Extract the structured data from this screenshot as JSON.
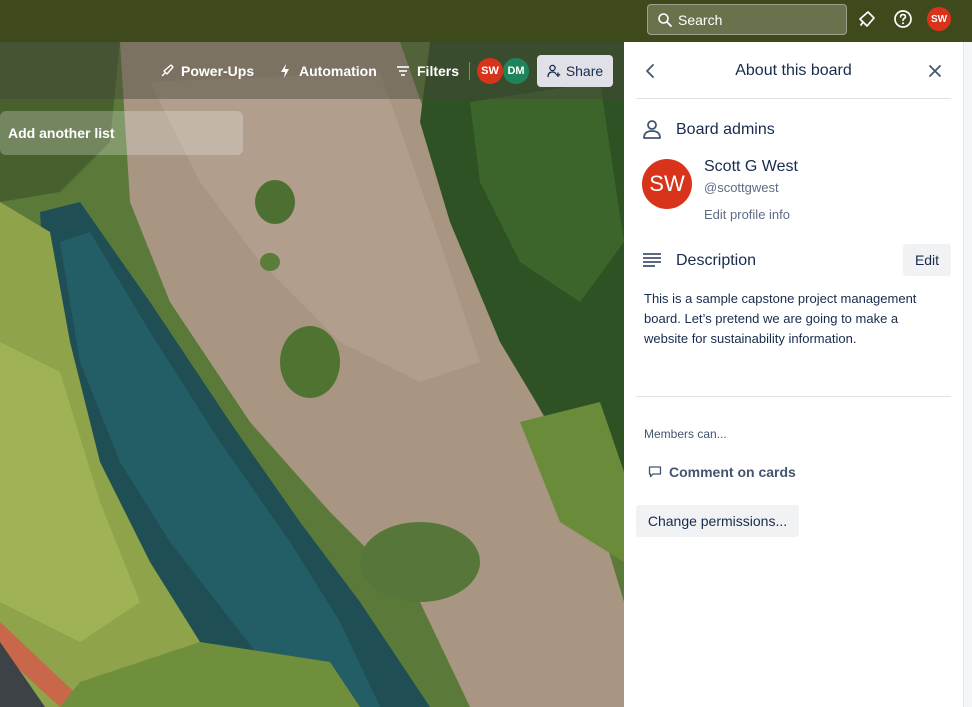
{
  "header": {
    "search_placeholder": "Search",
    "avatar_initials": "SW"
  },
  "board_bar": {
    "powerups_label": "Power-Ups",
    "automation_label": "Automation",
    "filters_label": "Filters",
    "members": [
      {
        "initials": "SW",
        "color": "#d8341c"
      },
      {
        "initials": "DM",
        "color": "#1f845a"
      }
    ],
    "share_label": "Share"
  },
  "board": {
    "add_list_label": "Add another list"
  },
  "panel": {
    "title": "About this board",
    "admins_title": "Board admins",
    "admin": {
      "initials": "SW",
      "name": "Scott G West",
      "username": "@scottgwest",
      "edit_profile": "Edit profile info"
    },
    "description_title": "Description",
    "edit_label": "Edit",
    "description_text": "This is a sample capstone project management board. Let’s pretend we are going to make a website for sustainability information.",
    "members_can": "Members can...",
    "comment_permission": "Comment on cards",
    "change_permissions_label": "Change permissions..."
  },
  "colors": {
    "header_bg": "#3f4a1c",
    "avatar_red": "#d8341c",
    "avatar_green": "#1f845a",
    "text_primary": "#172b4d"
  }
}
